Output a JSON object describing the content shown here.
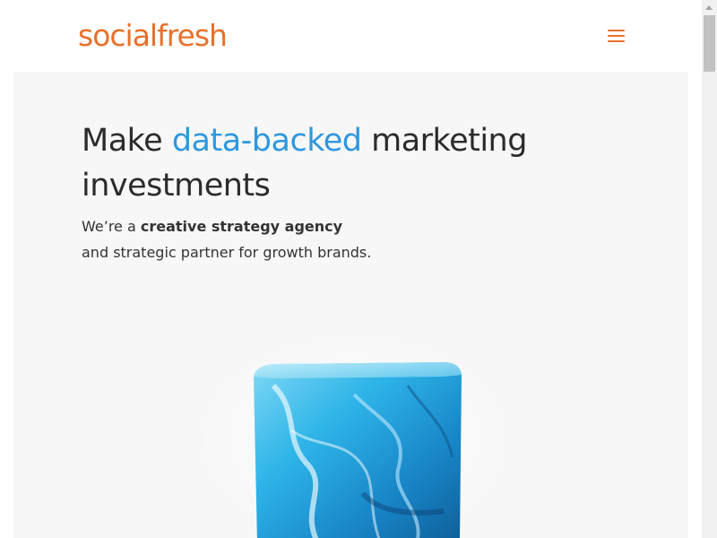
{
  "header": {
    "logo_text": "socialfresh",
    "menu_icon": "hamburger-menu-icon"
  },
  "hero": {
    "headline_part1": "Make ",
    "headline_accent": "data-backed",
    "headline_part2": " marketing investments",
    "subtitle_part1": "We’re a ",
    "subtitle_bold": "creative strategy agency",
    "subtitle_part2": "and strategic partner for growth brands.",
    "image": "blue-ice-cube-image"
  },
  "colors": {
    "brand_orange": "#e8702a",
    "accent_blue": "#2f97e0",
    "hero_background": "#f7f7f7",
    "text_dark": "#2b2b2b"
  }
}
